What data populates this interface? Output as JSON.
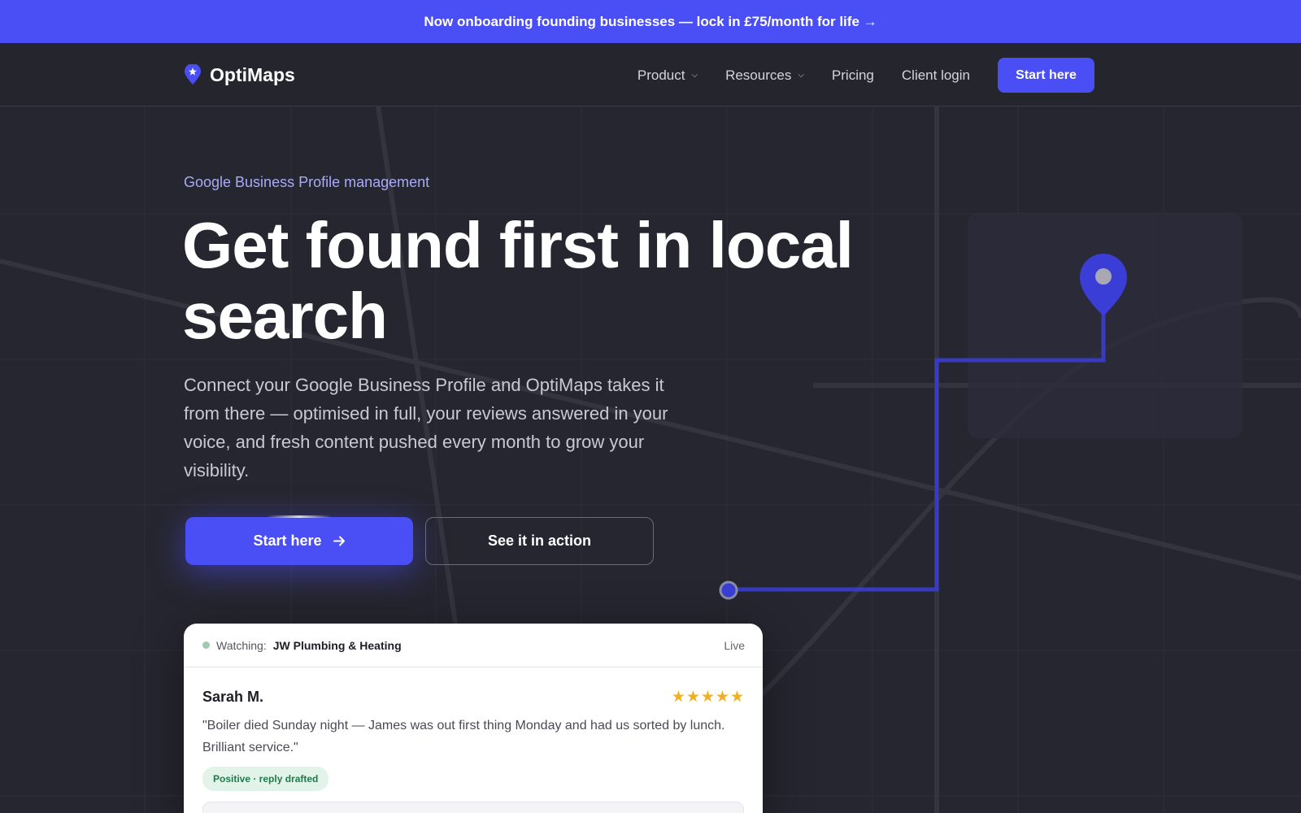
{
  "banner": {
    "text": "Now onboarding founding businesses — lock in £75/month for life →"
  },
  "nav": {
    "logo_text": "OptiMaps",
    "links": [
      {
        "label": "Product",
        "has_dropdown": true
      },
      {
        "label": "Resources",
        "has_dropdown": true
      },
      {
        "label": "Pricing",
        "has_dropdown": false
      },
      {
        "label": "Client login",
        "has_dropdown": false
      }
    ],
    "cta_label": "Start here"
  },
  "hero": {
    "eyebrow": "Google Business Profile management",
    "title_line1": "Get found first in local",
    "title_line2": "search",
    "subtitle": "Connect your Google Business Profile and OptiMaps takes it from there — optimised in full, your reviews answered in your voice, and fresh content pushed every month to grow your visibility.",
    "primary_button": "Start here",
    "primary_button_icon": "arrow-right-icon",
    "secondary_button": "See it in action"
  },
  "card": {
    "watching_label": "Watching:",
    "business_name": "JW Plumbing & Heating",
    "status": "Live",
    "review": {
      "author": "Sarah M.",
      "rating": 5,
      "stars": "★★★★★",
      "text": "\"Boiler died Sunday night — James was out first thing Monday and had us sorted by lunch. Brilliant service.\"",
      "badge": "Positive · reply drafted"
    }
  },
  "colors": {
    "accent": "#4a4ef5",
    "background": "#262630",
    "eyebrow": "#a9aaf8",
    "star": "#f2b01e",
    "badge_bg": "#e2f4ea",
    "badge_text": "#1f7a48"
  }
}
